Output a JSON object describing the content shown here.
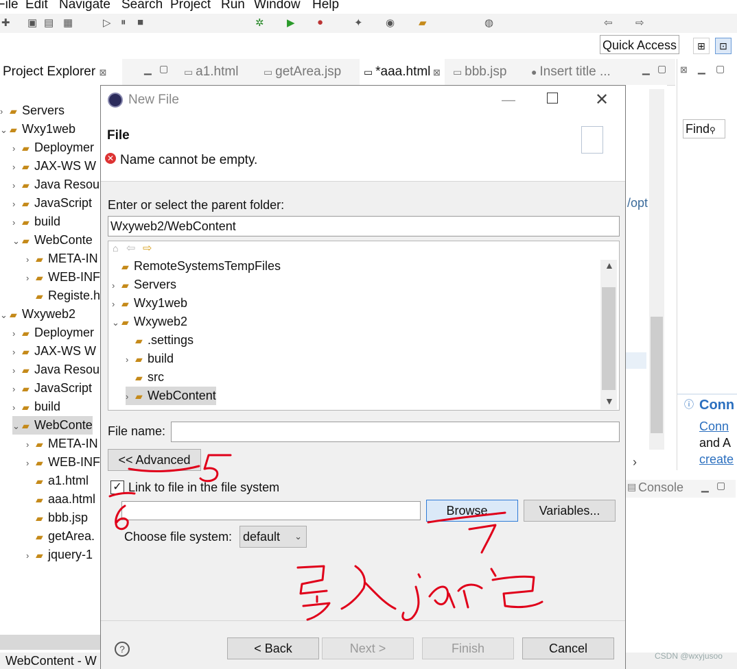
{
  "menu": [
    "File",
    "Edit",
    "Navigate",
    "Search",
    "Project",
    "Run",
    "Window",
    "Help"
  ],
  "toolbar": {
    "quick_access": "Quick Access"
  },
  "explorer": {
    "title": "Project Explorer",
    "items": [
      {
        "label": "Servers",
        "indent": 0
      },
      {
        "label": "Wxy1web",
        "indent": 0
      },
      {
        "label": "Deploymer",
        "indent": 1
      },
      {
        "label": "JAX-WS W",
        "indent": 1
      },
      {
        "label": "Java Resou",
        "indent": 1
      },
      {
        "label": "JavaScript",
        "indent": 1
      },
      {
        "label": "build",
        "indent": 1
      },
      {
        "label": "WebConte",
        "indent": 1
      },
      {
        "label": "META-IN",
        "indent": 2
      },
      {
        "label": "WEB-INF",
        "indent": 2
      },
      {
        "label": "Registe.h",
        "indent": 2
      },
      {
        "label": "Wxyweb2",
        "indent": 0
      },
      {
        "label": "Deploymer",
        "indent": 1
      },
      {
        "label": "JAX-WS W",
        "indent": 1
      },
      {
        "label": "Java Resou",
        "indent": 1
      },
      {
        "label": "JavaScript",
        "indent": 1
      },
      {
        "label": "build",
        "indent": 1
      },
      {
        "label": "WebConte",
        "indent": 1
      },
      {
        "label": "META-IN",
        "indent": 2
      },
      {
        "label": "WEB-INF",
        "indent": 2
      },
      {
        "label": "a1.html",
        "indent": 2
      },
      {
        "label": "aaa.html",
        "indent": 2
      },
      {
        "label": "bbb.jsp",
        "indent": 2
      },
      {
        "label": "getArea.",
        "indent": 2
      },
      {
        "label": "jquery-1",
        "indent": 2
      }
    ]
  },
  "editor_tabs": [
    "a1.html",
    "getArea.jsp",
    "*aaa.html",
    "bbb.jsp",
    "Insert title ..."
  ],
  "editor_fragment": "/opt",
  "right_panel": {
    "find": "Find",
    "connect_title": "Conn",
    "connect_link": "Conn",
    "and_text": "and A",
    "create_link": "create"
  },
  "console": {
    "label": "Console"
  },
  "status": {
    "left": "WebContent - W"
  },
  "dialog": {
    "title": "New File",
    "heading": "File",
    "error": "Name cannot be empty.",
    "parent_label": "Enter or select the parent folder:",
    "parent_value": "Wxyweb2/WebContent",
    "tree": [
      {
        "label": "RemoteSystemsTempFiles",
        "indent": 0
      },
      {
        "label": "Servers",
        "indent": 0
      },
      {
        "label": "Wxy1web",
        "indent": 0
      },
      {
        "label": "Wxyweb2",
        "indent": 0
      },
      {
        "label": ".settings",
        "indent": 1
      },
      {
        "label": "build",
        "indent": 1
      },
      {
        "label": "src",
        "indent": 1
      },
      {
        "label": "WebContent",
        "indent": 1
      }
    ],
    "file_name_label": "File name:",
    "file_name_value": "",
    "advanced_button": "<< Advanced",
    "link_checkbox": "Link to file in the file system",
    "link_checked": true,
    "link_path": "",
    "browse_button": "Browse...",
    "variables_button": "Variables...",
    "fs_label": "Choose file system:",
    "fs_value": "default",
    "back_button": "< Back",
    "next_button": "Next >",
    "finish_button": "Finish",
    "cancel_button": "Cancel"
  },
  "watermark": "CSDN @wxyjusoo",
  "colors": {
    "selection": "#d9d9d9",
    "focus_border": "#2f7bd6",
    "annotation": "#e0001a"
  }
}
